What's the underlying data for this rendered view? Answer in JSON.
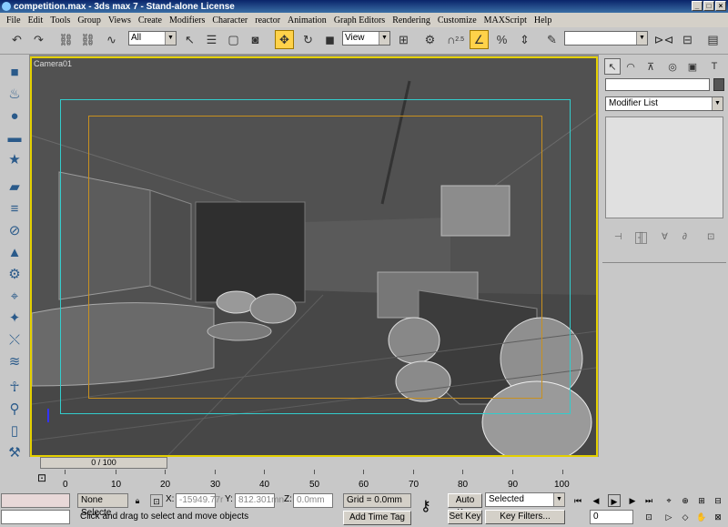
{
  "window": {
    "title": "competition.max - 3ds max 7 - Stand-alone License",
    "min": "_",
    "max": "□",
    "close": "×"
  },
  "menu": [
    "File",
    "Edit",
    "Tools",
    "Group",
    "Views",
    "Create",
    "Modifiers",
    "Character",
    "reactor",
    "Animation",
    "Graph Editors",
    "Rendering",
    "Customize",
    "MAXScript",
    "Help"
  ],
  "toolbar": {
    "selection_filter": "All",
    "ref_coord": "View",
    "snap_label": "2.5",
    "named_selection": ""
  },
  "viewport": {
    "label": "Camera01"
  },
  "command_panel": {
    "modifier_list": "Modifier List"
  },
  "timeline": {
    "slider": "0 / 100",
    "ticks": [
      "0",
      "10",
      "20",
      "30",
      "40",
      "50",
      "60",
      "70",
      "80",
      "90",
      "100"
    ]
  },
  "status": {
    "selection": "None Selecte",
    "x_label": "X:",
    "x_value": "-15949.77r",
    "y_label": "Y:",
    "y_value": "812.301mn",
    "z_label": "Z:",
    "z_value": "0.0mm",
    "grid": "Grid = 0.0mm",
    "prompt": "Click and drag to select and move objects",
    "add_time_tag": "Add Time Tag"
  },
  "anim": {
    "auto_key": "Auto Key",
    "set_key": "Set Key",
    "selected": "Selected",
    "key_filters": "Key Filters...",
    "frame": "0"
  }
}
